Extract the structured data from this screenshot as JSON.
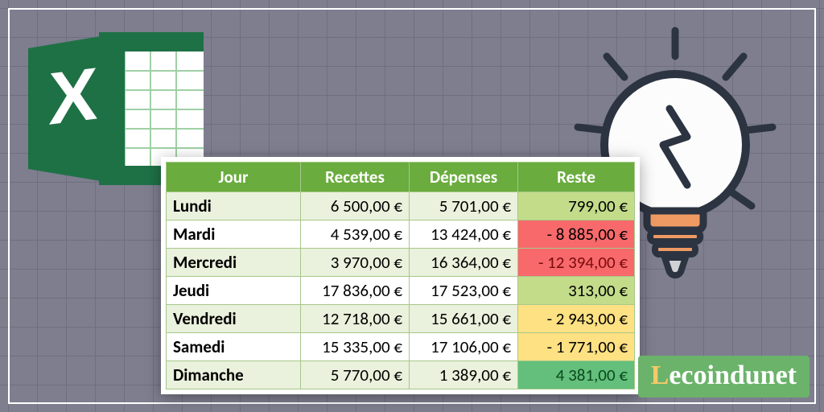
{
  "brand": {
    "logo_prefix": "L",
    "logo_rest": "ecoindunet"
  },
  "icons": {
    "excel": "excel-icon",
    "bulb": "lightbulb-icon"
  },
  "table": {
    "headers": [
      "Jour",
      "Recettes",
      "Dépenses",
      "Reste"
    ],
    "rows": [
      {
        "day": "Lundi",
        "recettes": "6 500,00 €",
        "depenses": "5 701,00 €",
        "reste": "799,00 €",
        "reste_class": "bg-green-light"
      },
      {
        "day": "Mardi",
        "recettes": "4 539,00 €",
        "depenses": "13 424,00 €",
        "reste": "-  8 885,00 €",
        "reste_class": "bg-red"
      },
      {
        "day": "Mercredi",
        "recettes": "3 970,00 €",
        "depenses": "16 364,00 €",
        "reste": "- 12 394,00 €",
        "reste_class": "bg-red-deep"
      },
      {
        "day": "Jeudi",
        "recettes": "17 836,00 €",
        "depenses": "17 523,00 €",
        "reste": "313,00 €",
        "reste_class": "bg-green-light"
      },
      {
        "day": "Vendredi",
        "recettes": "12 718,00 €",
        "depenses": "15 661,00 €",
        "reste": "-  2 943,00 €",
        "reste_class": "bg-yellow"
      },
      {
        "day": "Samedi",
        "recettes": "15 335,00 €",
        "depenses": "17 106,00 €",
        "reste": "-  1 771,00 €",
        "reste_class": "bg-yellow"
      },
      {
        "day": "Dimanche",
        "recettes": "5 770,00 €",
        "depenses": "1 389,00 €",
        "reste": "4 381,00 €",
        "reste_class": "bg-green-deep"
      }
    ]
  }
}
